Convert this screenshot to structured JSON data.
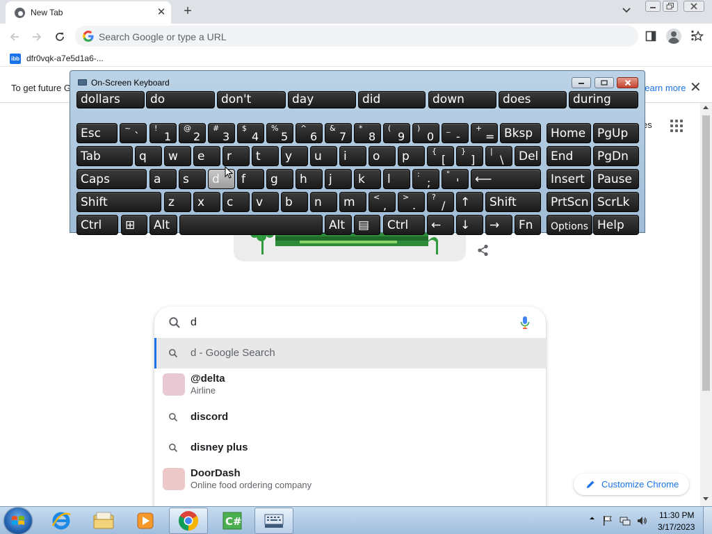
{
  "browser": {
    "tab_title": "New Tab",
    "omnibox_placeholder": "Search Google or type a URL",
    "bookmark_icon_text": "ibb",
    "bookmark_label": "dfr0vqk-a7e5d1a6-...",
    "infobar_text": "To get future G",
    "infobar_link": "Learn more"
  },
  "page": {
    "images_link": "es",
    "search_value": "d",
    "suggestions": [
      {
        "main": "d - Google Search",
        "sub": "",
        "kind": "search"
      },
      {
        "main": "@delta",
        "sub": "Airline",
        "kind": "entity"
      },
      {
        "main": "discord",
        "sub": "",
        "kind": "search"
      },
      {
        "main": "disney plus",
        "sub": "",
        "kind": "search"
      },
      {
        "main": "DoorDash",
        "sub": "Online food ordering company",
        "kind": "entity"
      }
    ],
    "customize_label": "Customize Chrome"
  },
  "osk": {
    "title": "On-Screen Keyboard",
    "predictions": [
      "dollars",
      "do",
      "don't",
      "day",
      "did",
      "down",
      "does",
      "during"
    ],
    "rows": [
      [
        {
          "l": "Esc"
        },
        {
          "s": "~",
          "b": "`"
        },
        {
          "s": "!",
          "b": "1"
        },
        {
          "s": "@",
          "b": "2"
        },
        {
          "s": "#",
          "b": "3"
        },
        {
          "s": "$",
          "b": "4"
        },
        {
          "s": "%",
          "b": "5"
        },
        {
          "s": "^",
          "b": "6"
        },
        {
          "s": "&",
          "b": "7"
        },
        {
          "s": "*",
          "b": "8"
        },
        {
          "s": "(",
          "b": "9"
        },
        {
          "s": ")",
          "b": "0"
        },
        {
          "s": "_",
          "b": "-"
        },
        {
          "s": "+",
          "b": "="
        },
        {
          "l": "Bksp"
        },
        {
          "l": "Home"
        },
        {
          "l": "PgUp"
        }
      ],
      [
        {
          "l": "Tab"
        },
        {
          "l": "q"
        },
        {
          "l": "w"
        },
        {
          "l": "e"
        },
        {
          "l": "r"
        },
        {
          "l": "t"
        },
        {
          "l": "y"
        },
        {
          "l": "u"
        },
        {
          "l": "i"
        },
        {
          "l": "o"
        },
        {
          "l": "p"
        },
        {
          "s": "{",
          "b": "["
        },
        {
          "s": "}",
          "b": "]"
        },
        {
          "s": "|",
          "b": "\\"
        },
        {
          "l": "Del"
        },
        {
          "l": "End"
        },
        {
          "l": "PgDn"
        }
      ],
      [
        {
          "l": "Caps"
        },
        {
          "l": "a"
        },
        {
          "l": "s"
        },
        {
          "l": "d"
        },
        {
          "l": "f"
        },
        {
          "l": "g"
        },
        {
          "l": "h"
        },
        {
          "l": "j"
        },
        {
          "l": "k"
        },
        {
          "l": "l"
        },
        {
          "s": ":",
          "b": ";"
        },
        {
          "s": "\"",
          "b": "'"
        },
        {
          "l": "⟵"
        },
        {
          "l": "Insert"
        },
        {
          "l": "Pause"
        }
      ],
      [
        {
          "l": "Shift"
        },
        {
          "l": "z"
        },
        {
          "l": "x"
        },
        {
          "l": "c"
        },
        {
          "l": "v"
        },
        {
          "l": "b"
        },
        {
          "l": "n"
        },
        {
          "l": "m"
        },
        {
          "s": "<",
          "b": ","
        },
        {
          "s": ">",
          "b": "."
        },
        {
          "s": "?",
          "b": "/"
        },
        {
          "l": "↑"
        },
        {
          "l": "Shift"
        },
        {
          "l": "PrtScn"
        },
        {
          "l": "ScrLk"
        }
      ],
      [
        {
          "l": "Ctrl"
        },
        {
          "l": "⊞"
        },
        {
          "l": "Alt"
        },
        {
          "l": ""
        },
        {
          "l": "Alt"
        },
        {
          "l": "▤"
        },
        {
          "l": "Ctrl"
        },
        {
          "l": "←"
        },
        {
          "l": "↓"
        },
        {
          "l": "→"
        },
        {
          "l": "Fn"
        },
        {
          "l": "Options"
        },
        {
          "l": "Help"
        }
      ]
    ],
    "highlighted_key": "d"
  },
  "taskbar": {
    "time": "11:30 PM",
    "date": "3/17/2023",
    "apps": [
      "internet-explorer",
      "windows-explorer",
      "media-player",
      "google-chrome",
      "csharp-ide",
      "on-screen-keyboard"
    ],
    "active_app": "google-chrome"
  }
}
